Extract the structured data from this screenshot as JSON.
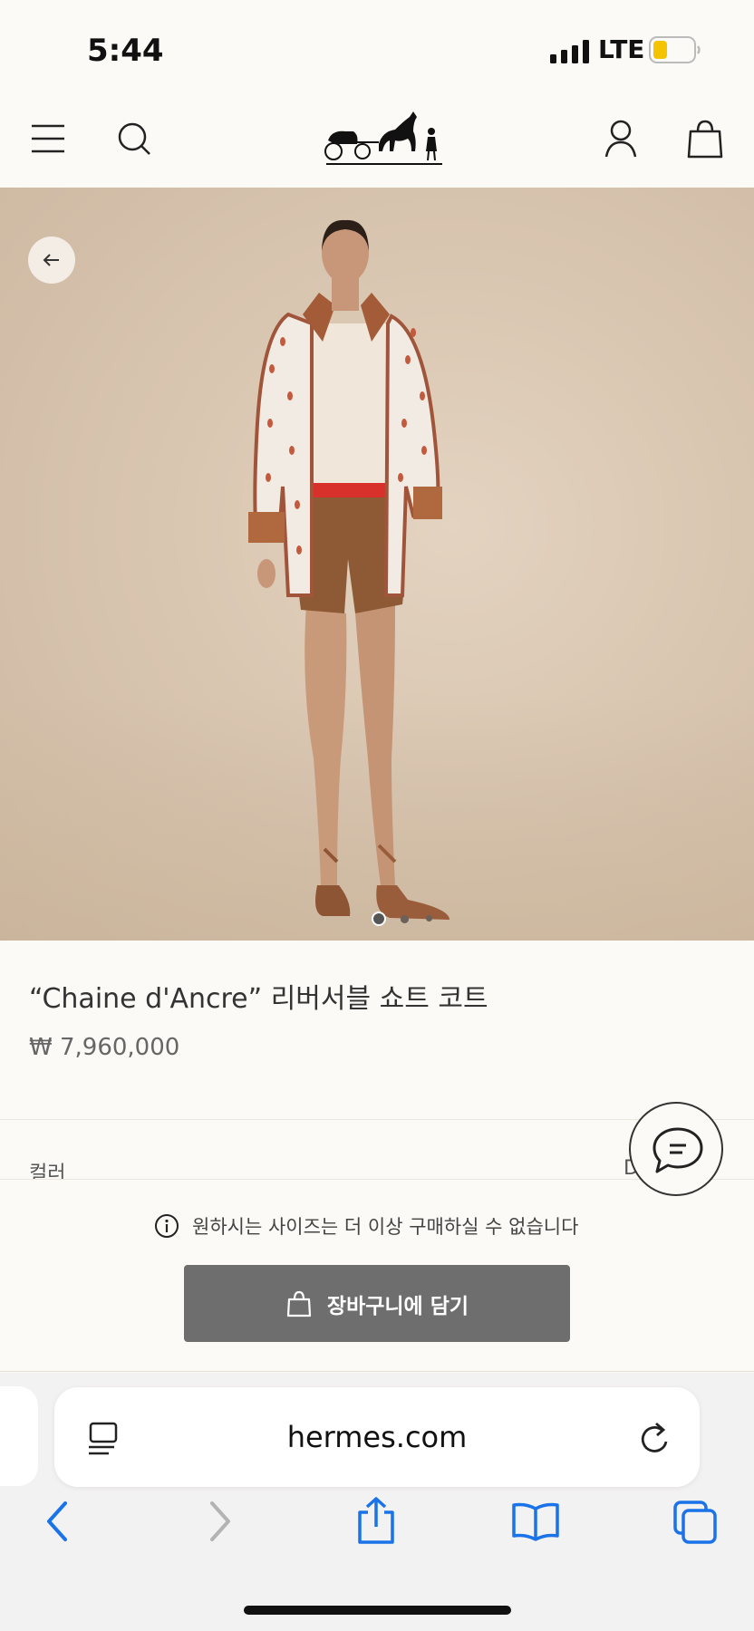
{
  "status_bar": {
    "time": "5:44",
    "network": "LTE",
    "battery_level": 0.35,
    "battery_color": "#f5c400"
  },
  "header": {
    "icons": [
      "menu-icon",
      "search-icon",
      "hermes-logo",
      "account-icon",
      "shopping-bag-icon"
    ]
  },
  "gallery": {
    "current_slide": 1,
    "total_slides": 3
  },
  "product": {
    "title": "“Chaine d'Ancre” 리버서블 쇼트 코트",
    "price": "₩ 7,960,000",
    "color_label": "컬러",
    "color_value": "D"
  },
  "purchase": {
    "notice": "원하시는 사이즈는 더 이상 구매하실 수 없습니다",
    "cart_button_label": "장바구니에 담기",
    "cart_button_color": "#6e6e6e"
  },
  "browser": {
    "url": "hermes.com",
    "accent_color": "#1a73e8",
    "toolbar": [
      "back-icon",
      "forward-icon",
      "share-icon",
      "bookmarks-icon",
      "tabs-icon"
    ]
  }
}
